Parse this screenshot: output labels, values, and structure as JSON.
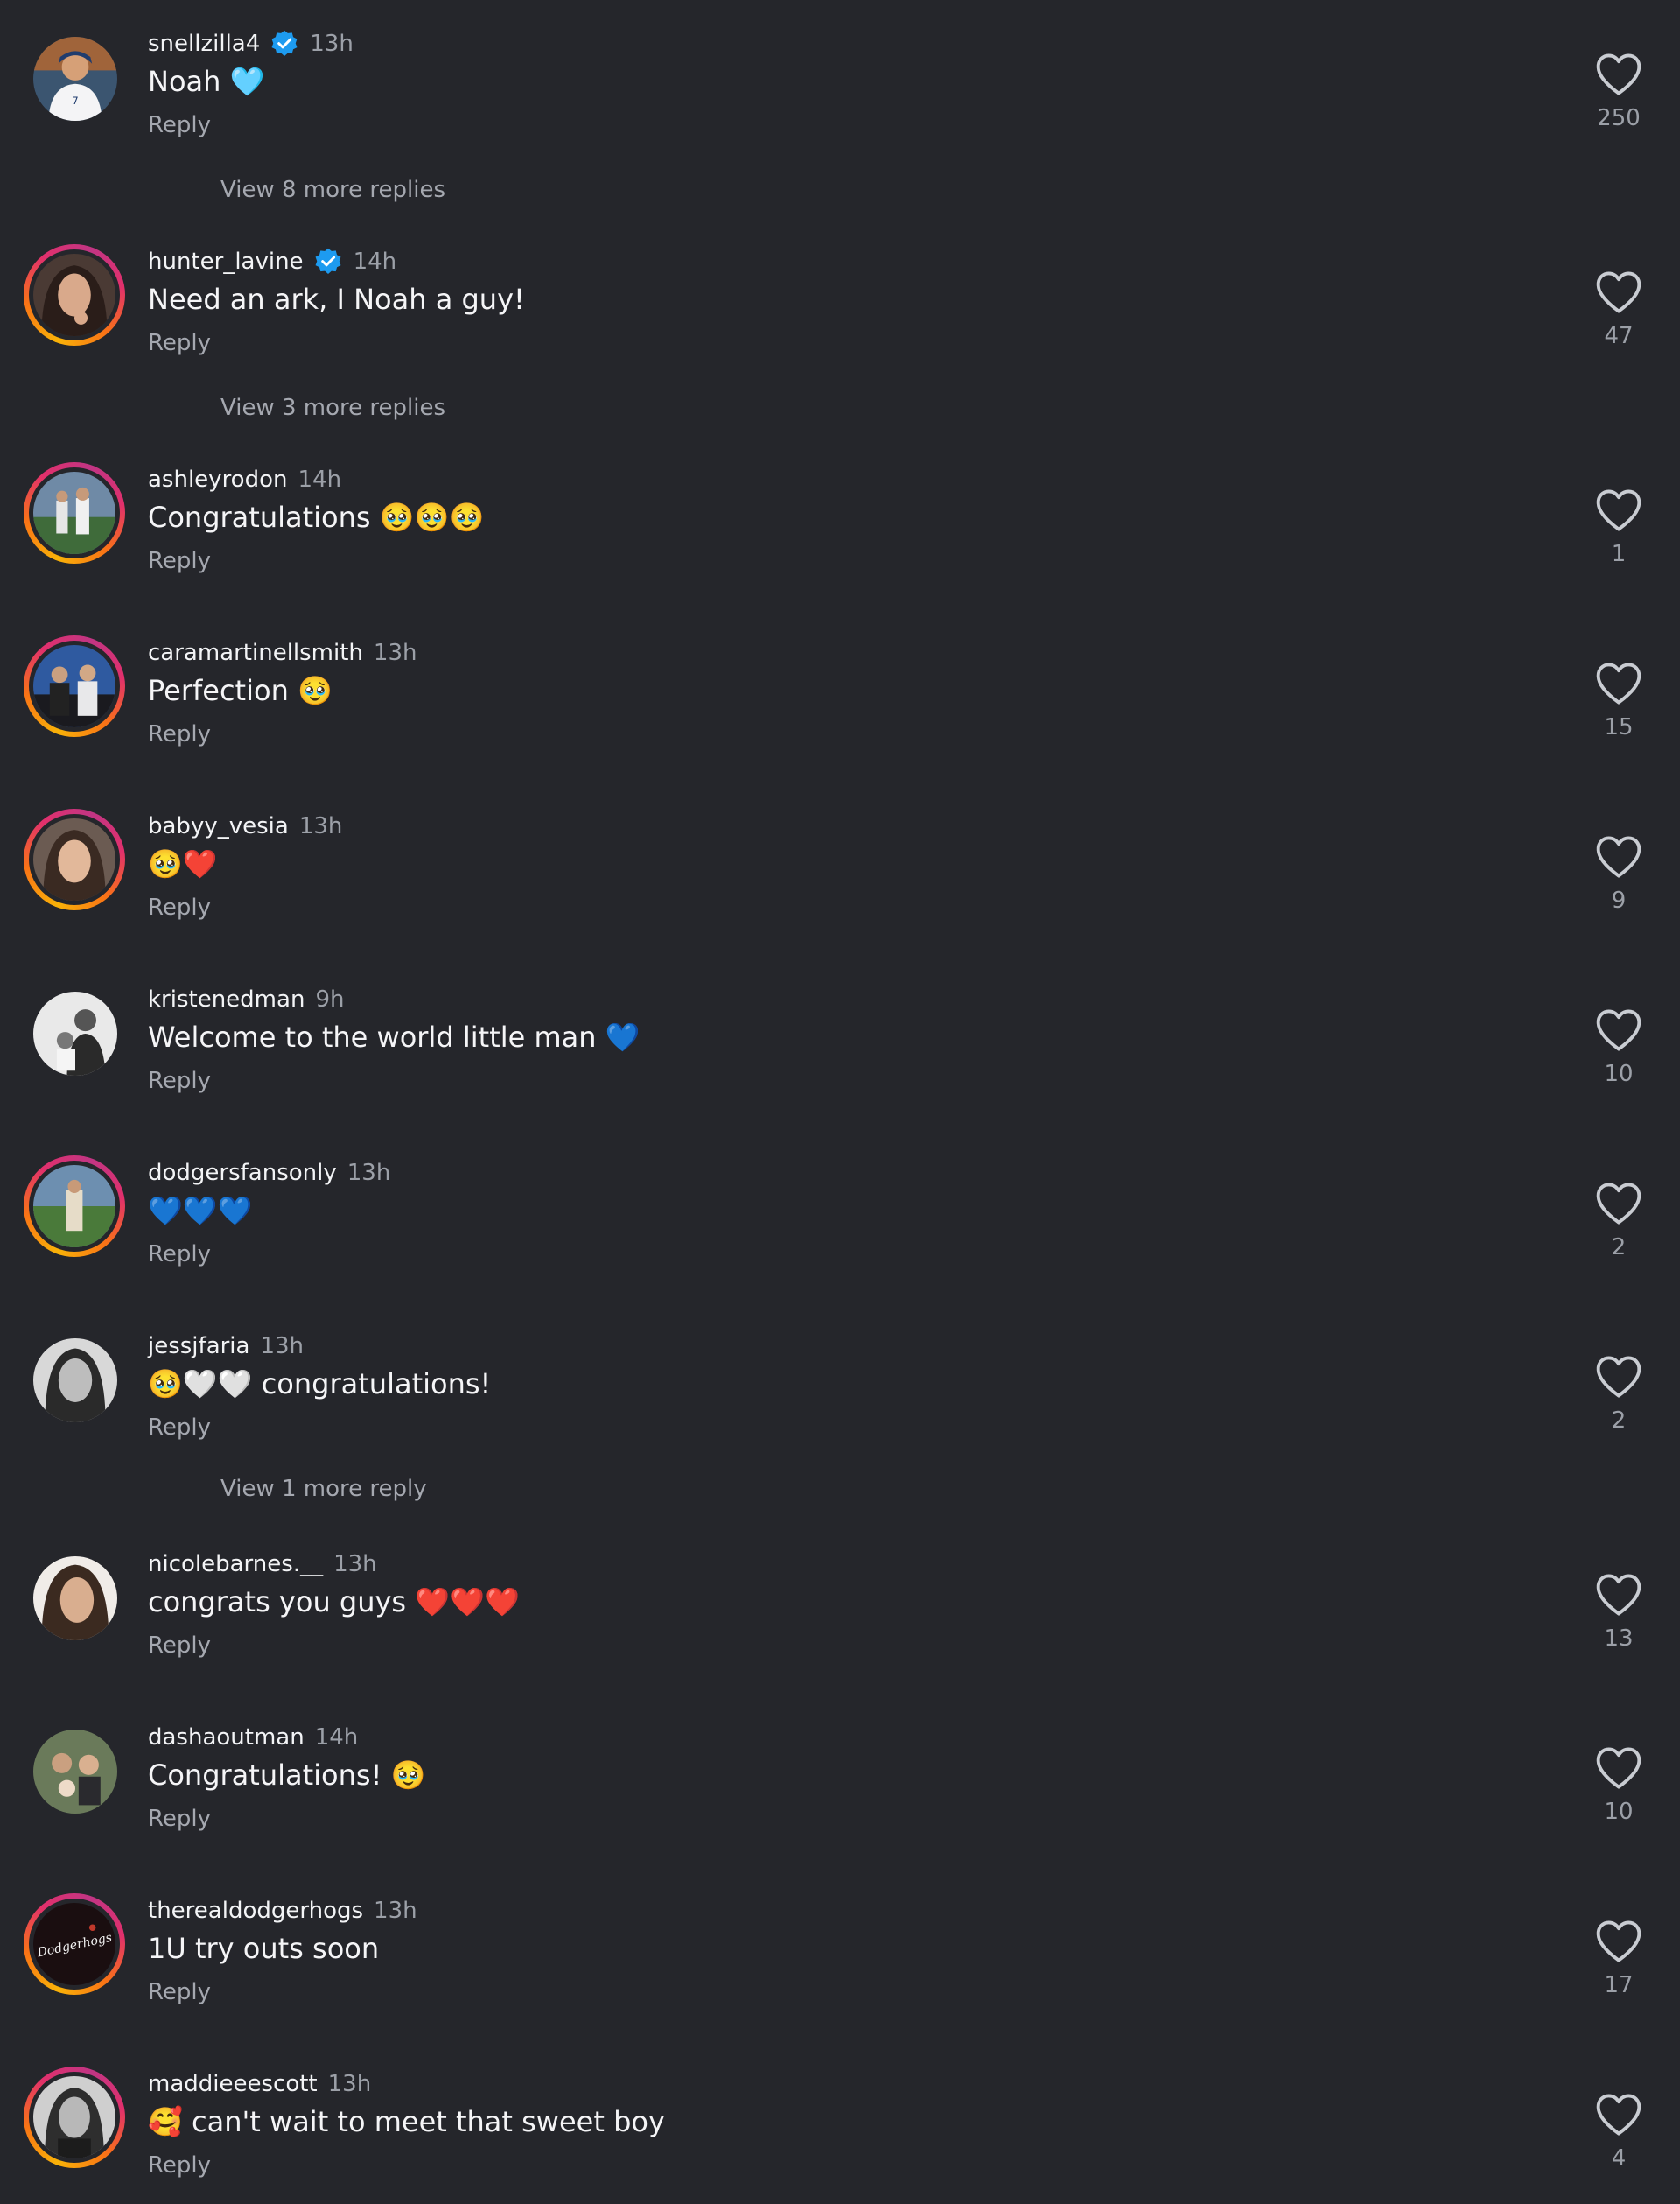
{
  "reply_label": "Reply",
  "colors": {
    "background": "#25262b",
    "verified": "#1d9bf0",
    "secondary_text": "#9ca0a8"
  },
  "comments": [
    {
      "username": "snellzilla4",
      "verified": true,
      "time": "13h",
      "text": "Noah 🩵",
      "likes": "250",
      "view_more": "View 8 more replies",
      "avatar_style": "plain"
    },
    {
      "username": "hunter_lavine",
      "verified": true,
      "time": "14h",
      "text": "Need an ark, I Noah a guy!",
      "likes": "47",
      "view_more": "View 3 more replies",
      "avatar_style": "story"
    },
    {
      "username": "ashleyrodon",
      "verified": false,
      "time": "14h",
      "text": "Congratulations 🥹🥹🥹",
      "likes": "1",
      "avatar_style": "story"
    },
    {
      "username": "caramartinellsmith",
      "verified": false,
      "time": "13h",
      "text": "Perfection 🥹",
      "likes": "15",
      "avatar_style": "story"
    },
    {
      "username": "babyy_vesia",
      "verified": false,
      "time": "13h",
      "text": "🥹❤️",
      "likes": "9",
      "avatar_style": "story"
    },
    {
      "username": "kristenedman",
      "verified": false,
      "time": "9h",
      "text": "Welcome to the world little man 💙",
      "likes": "10",
      "avatar_style": "plain"
    },
    {
      "username": "dodgersfansonly",
      "verified": false,
      "time": "13h",
      "text": "💙💙💙",
      "likes": "2",
      "avatar_style": "story"
    },
    {
      "username": "jessjfaria",
      "verified": false,
      "time": "13h",
      "text": "🥹🤍🤍 congratulations!",
      "likes": "2",
      "view_more": "View 1 more reply",
      "avatar_style": "plain"
    },
    {
      "username": "nicolebarnes.__",
      "verified": false,
      "time": "13h",
      "text": "congrats you guys ❤️❤️❤️",
      "likes": "13",
      "avatar_style": "plain"
    },
    {
      "username": "dashaoutman",
      "verified": false,
      "time": "14h",
      "text": "Congratulations! 🥹",
      "likes": "10",
      "avatar_style": "plain"
    },
    {
      "username": "therealdodgerhogs",
      "verified": false,
      "time": "13h",
      "text": "1U try outs soon",
      "likes": "17",
      "avatar_style": "story",
      "avatar_text": "Dodgerhogs"
    },
    {
      "username": "maddieeescott",
      "verified": false,
      "time": "13h",
      "text": "🥰 can't wait to meet that sweet boy",
      "likes": "4",
      "avatar_style": "story"
    }
  ]
}
